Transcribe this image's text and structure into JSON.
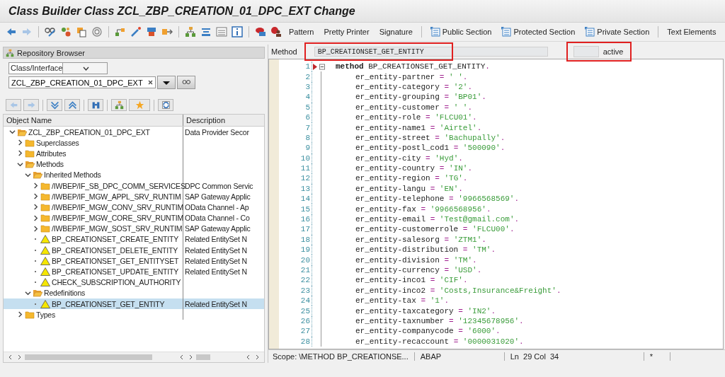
{
  "window": {
    "title": "Class Builder Class ZCL_ZBP_CREATION_01_DPC_EXT Change"
  },
  "toolbar": {
    "buttons": [
      {
        "label": "Pattern",
        "kind": "plain"
      },
      {
        "label": "Pretty Printer",
        "kind": "plain"
      },
      {
        "label": "Signature",
        "kind": "plain"
      },
      {
        "label": "Public Section",
        "kind": "section"
      },
      {
        "label": "Protected Section",
        "kind": "section"
      },
      {
        "label": "Private Section",
        "kind": "section"
      },
      {
        "label": "Text Elements",
        "kind": "plain"
      }
    ]
  },
  "browser": {
    "title": "Repository Browser",
    "object_type": "Class/Interface",
    "object_name": "ZCL_ZBP_CREATION_01_DPC_EXT",
    "columns": [
      "Object Name",
      "Description"
    ],
    "tree": [
      {
        "label": "ZCL_ZBP_CREATION_01_DPC_EXT",
        "description": "Data Provider Secor",
        "kind": "folder",
        "expanded": true,
        "selected": false,
        "children": [
          {
            "label": "Superclasses",
            "kind": "folder",
            "expanded": false,
            "selected": false
          },
          {
            "label": "Attributes",
            "kind": "folder",
            "expanded": false,
            "selected": false
          },
          {
            "label": "Methods",
            "kind": "folder",
            "expanded": true,
            "selected": false,
            "children": [
              {
                "label": "Inherited Methods",
                "kind": "folder",
                "expanded": true,
                "selected": false,
                "children": [
                  {
                    "label": "/IWBEP/IF_SB_DPC_COMM_SERVICES",
                    "description": "DPC Common Servic",
                    "kind": "folder",
                    "expanded": false,
                    "selected": false
                  },
                  {
                    "label": "/IWBEP/IF_MGW_APPL_SRV_RUNTIM",
                    "description": "SAP Gateway Applic",
                    "kind": "folder",
                    "expanded": false,
                    "selected": false
                  },
                  {
                    "label": "/IWBEP/IF_MGW_CONV_SRV_RUNTIM",
                    "description": "OData Channel - Ap",
                    "kind": "folder",
                    "expanded": false,
                    "selected": false
                  },
                  {
                    "label": "/IWBEP/IF_MGW_CORE_SRV_RUNTIM",
                    "description": "OData Channel - Co",
                    "kind": "folder",
                    "expanded": false,
                    "selected": false
                  },
                  {
                    "label": "/IWBEP/IF_MGW_SOST_SRV_RUNTIM",
                    "description": "SAP Gateway Applic",
                    "kind": "folder",
                    "expanded": false,
                    "selected": false
                  },
                  {
                    "label": "BP_CREATIONSET_CREATE_ENTITY",
                    "description": "Related EntitySet N",
                    "kind": "method",
                    "selected": false
                  },
                  {
                    "label": "BP_CREATIONSET_DELETE_ENTITY",
                    "description": "Related EntitySet N",
                    "kind": "method",
                    "selected": false
                  },
                  {
                    "label": "BP_CREATIONSET_GET_ENTITYSET",
                    "description": "Related EntitySet N",
                    "kind": "method",
                    "selected": false
                  },
                  {
                    "label": "BP_CREATIONSET_UPDATE_ENTITY",
                    "description": "Related EntitySet N",
                    "kind": "method",
                    "selected": false
                  },
                  {
                    "label": "CHECK_SUBSCRIPTION_AUTHORITY",
                    "kind": "method",
                    "selected": false
                  }
                ]
              },
              {
                "label": "Redefinitions",
                "kind": "folder",
                "expanded": true,
                "selected": false,
                "children": [
                  {
                    "label": "BP_CREATIONSET_GET_ENTITY",
                    "description": "Related EntitySet N",
                    "kind": "method",
                    "selected": true
                  }
                ]
              }
            ]
          },
          {
            "label": "Types",
            "kind": "folder",
            "expanded": false,
            "selected": false
          }
        ]
      }
    ]
  },
  "editor": {
    "method_label": "Method",
    "method_name": "BP_CREATIONSET_GET_ENTITY",
    "status": "active",
    "lines": [
      {
        "n": "1",
        "kind": "method",
        "keyword": "method",
        "name": "BP_CREATIONSET_GET_ENTITY",
        "end": "."
      },
      {
        "n": "2",
        "kind": "assign",
        "field": "er_entity-partner",
        "op": "=",
        "literal": "' '",
        "end": "."
      },
      {
        "n": "3",
        "kind": "assign",
        "field": "er_entity-category",
        "op": "=",
        "literal": "'2'",
        "end": "."
      },
      {
        "n": "4",
        "kind": "assign",
        "field": "er_entity-grouping",
        "op": "=",
        "literal": "'BP01'",
        "end": "."
      },
      {
        "n": "5",
        "kind": "assign",
        "field": "er_entity-customer",
        "op": "=",
        "literal": "' '",
        "end": "."
      },
      {
        "n": "6",
        "kind": "assign",
        "field": "er_entity-role",
        "op": "=",
        "literal": "'FLCU01'",
        "end": "."
      },
      {
        "n": "7",
        "kind": "assign",
        "field": "er_entity-name1",
        "op": "=",
        "literal": "'Airtel'",
        "end": "."
      },
      {
        "n": "8",
        "kind": "assign",
        "field": "er_entity-street",
        "op": "=",
        "literal": "'Bachupally'",
        "end": "."
      },
      {
        "n": "9",
        "kind": "assign",
        "field": "er_entity-postl_cod1",
        "op": "=",
        "literal": "'500090'",
        "end": "."
      },
      {
        "n": "10",
        "kind": "assign",
        "field": "er_entity-city",
        "op": "=",
        "literal": "'Hyd'",
        "end": "."
      },
      {
        "n": "11",
        "kind": "assign",
        "field": "er_entity-country",
        "op": "=",
        "literal": "'IN'",
        "end": "."
      },
      {
        "n": "12",
        "kind": "assign",
        "field": "er_entity-region",
        "op": "=",
        "literal": "'TG'",
        "end": "."
      },
      {
        "n": "13",
        "kind": "assign",
        "field": "er_entity-langu",
        "op": "=",
        "literal": "'EN'",
        "end": "."
      },
      {
        "n": "14",
        "kind": "assign",
        "field": "er_entity-telephone",
        "op": "=",
        "literal": "'9966568569'",
        "end": "."
      },
      {
        "n": "15",
        "kind": "assign",
        "field": "er_entity-fax",
        "op": "=",
        "literal": "'9966568956'",
        "end": "."
      },
      {
        "n": "16",
        "kind": "assign",
        "field": "er_entity-email",
        "op": "=",
        "literal": "'Test@gmail.com'",
        "end": "."
      },
      {
        "n": "17",
        "kind": "assign",
        "field": "er_entity-customerrole",
        "op": "=",
        "literal": "'FLCU00'",
        "end": "."
      },
      {
        "n": "18",
        "kind": "assign",
        "field": "er_entity-salesorg",
        "op": "=",
        "literal": "'ZTM1'",
        "end": "."
      },
      {
        "n": "19",
        "kind": "assign",
        "field": "er_entity-distribution",
        "op": "=",
        "literal": "'TM'",
        "end": "."
      },
      {
        "n": "20",
        "kind": "assign",
        "field": "er_entity-division",
        "op": "=",
        "literal": "'TM'",
        "end": "."
      },
      {
        "n": "21",
        "kind": "assign",
        "field": "er_entity-currency",
        "op": "=",
        "literal": "'USD'",
        "end": "."
      },
      {
        "n": "22",
        "kind": "assign",
        "field": "er_entity-inco1",
        "op": "=",
        "literal": "'CIF'",
        "end": "."
      },
      {
        "n": "23",
        "kind": "assign",
        "field": "er_entity-inco2",
        "op": "=",
        "literal": "'Costs,Insurance&Freight'",
        "end": "."
      },
      {
        "n": "24",
        "kind": "assign",
        "field": "er_entity-tax",
        "op": "=",
        "literal": "'1'",
        "end": "."
      },
      {
        "n": "25",
        "kind": "assign",
        "field": "er_entity-taxcategory",
        "op": "=",
        "literal": "'IN2'",
        "end": "."
      },
      {
        "n": "26",
        "kind": "assign",
        "field": "er_entity-taxnumber",
        "op": "=",
        "literal": "'12345678956'",
        "end": "."
      },
      {
        "n": "27",
        "kind": "assign",
        "field": "er_entity-companycode",
        "op": "=",
        "literal": "'6000'",
        "end": "."
      },
      {
        "n": "28",
        "kind": "assign",
        "field": "er_entity-recaccount",
        "op": "=",
        "literal": "'0000031020'",
        "end": "."
      }
    ]
  },
  "status_bar": {
    "scope": "Scope: \\METHOD BP_CREATIONSE...",
    "language": "ABAP",
    "position": "Ln  29 Col  34",
    "mode": "*"
  }
}
